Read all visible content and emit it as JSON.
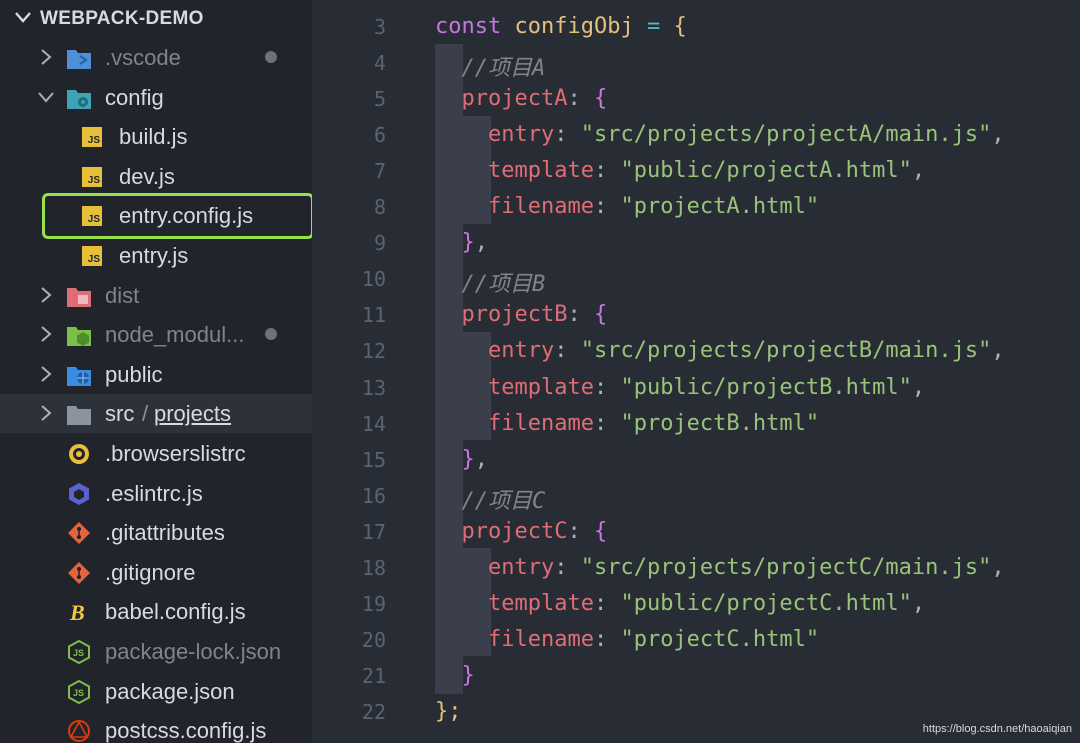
{
  "sidebar": {
    "header": "WEBPACK-DEMO",
    "items": [
      {
        "label": ".vscode",
        "icon": "vscode-folder-icon",
        "chevron": "right",
        "dim": true,
        "dot": true
      },
      {
        "label": "config",
        "icon": "config-folder-icon",
        "chevron": "down"
      },
      {
        "label": "build.js",
        "icon": "javascript-file-icon"
      },
      {
        "label": "dev.js",
        "icon": "javascript-file-icon"
      },
      {
        "label": "entry.config.js",
        "icon": "javascript-file-icon",
        "highlighted": true
      },
      {
        "label": "entry.js",
        "icon": "javascript-file-icon"
      },
      {
        "label": "dist",
        "icon": "dist-folder-icon",
        "chevron": "right",
        "dim": true
      },
      {
        "label": "node_modul...",
        "icon": "node-folder-icon",
        "chevron": "right",
        "dim": true,
        "dot": true
      },
      {
        "label": "public",
        "icon": "public-folder-icon",
        "chevron": "right"
      },
      {
        "label": "src",
        "label_suffix": "projects",
        "icon": "folder-icon",
        "chevron": "right",
        "selected": true
      },
      {
        "label": ".browserslistrc",
        "icon": "browserslist-icon"
      },
      {
        "label": ".eslintrc.js",
        "icon": "eslint-icon"
      },
      {
        "label": ".gitattributes",
        "icon": "git-icon"
      },
      {
        "label": ".gitignore",
        "icon": "git-icon"
      },
      {
        "label": "babel.config.js",
        "icon": "babel-icon"
      },
      {
        "label": "package-lock.json",
        "icon": "nodejs-icon",
        "dim": true
      },
      {
        "label": "package.json",
        "icon": "nodejs-icon"
      },
      {
        "label": "postcss.config.js",
        "icon": "postcss-icon"
      }
    ],
    "separator": "/"
  },
  "editor": {
    "lines": [
      {
        "n": "3",
        "t": [
          [
            "kw",
            "const "
          ],
          [
            "var",
            "configObj"
          ],
          [
            "op",
            " = "
          ],
          [
            "br",
            "{"
          ]
        ]
      },
      {
        "n": "4",
        "t": [
          [
            "cm",
            "  //项目A"
          ]
        ]
      },
      {
        "n": "5",
        "t": [
          [
            "prop",
            "  projectA"
          ],
          [
            "pun",
            ": "
          ],
          [
            "br2",
            "{"
          ]
        ]
      },
      {
        "n": "6",
        "t": [
          [
            "prop",
            "    entry"
          ],
          [
            "pun",
            ": "
          ],
          [
            "str",
            "\"src/projects/projectA/main.js\""
          ],
          [
            "pun",
            ","
          ]
        ]
      },
      {
        "n": "7",
        "t": [
          [
            "prop",
            "    template"
          ],
          [
            "pun",
            ": "
          ],
          [
            "str",
            "\"public/projectA.html\""
          ],
          [
            "pun",
            ","
          ]
        ]
      },
      {
        "n": "8",
        "t": [
          [
            "prop",
            "    filename"
          ],
          [
            "pun",
            ": "
          ],
          [
            "str",
            "\"projectA.html\""
          ]
        ]
      },
      {
        "n": "9",
        "t": [
          [
            "br2",
            "  }"
          ],
          [
            "pun",
            ","
          ]
        ]
      },
      {
        "n": "10",
        "t": [
          [
            "cm",
            "  //项目B"
          ]
        ]
      },
      {
        "n": "11",
        "t": [
          [
            "prop",
            "  projectB"
          ],
          [
            "pun",
            ": "
          ],
          [
            "br2",
            "{"
          ]
        ]
      },
      {
        "n": "12",
        "t": [
          [
            "prop",
            "    entry"
          ],
          [
            "pun",
            ": "
          ],
          [
            "str",
            "\"src/projects/projectB/main.js\""
          ],
          [
            "pun",
            ","
          ]
        ]
      },
      {
        "n": "13",
        "t": [
          [
            "prop",
            "    template"
          ],
          [
            "pun",
            ": "
          ],
          [
            "str",
            "\"public/projectB.html\""
          ],
          [
            "pun",
            ","
          ]
        ]
      },
      {
        "n": "14",
        "t": [
          [
            "prop",
            "    filename"
          ],
          [
            "pun",
            ": "
          ],
          [
            "str",
            "\"projectB.html\""
          ]
        ]
      },
      {
        "n": "15",
        "t": [
          [
            "br2",
            "  }"
          ],
          [
            "pun",
            ","
          ]
        ]
      },
      {
        "n": "16",
        "t": [
          [
            "cm",
            "  //项目C"
          ]
        ]
      },
      {
        "n": "17",
        "t": [
          [
            "prop",
            "  projectC"
          ],
          [
            "pun",
            ": "
          ],
          [
            "br2",
            "{"
          ]
        ]
      },
      {
        "n": "18",
        "t": [
          [
            "prop",
            "    entry"
          ],
          [
            "pun",
            ": "
          ],
          [
            "str",
            "\"src/projects/projectC/main.js\""
          ],
          [
            "pun",
            ","
          ]
        ]
      },
      {
        "n": "19",
        "t": [
          [
            "prop",
            "    template"
          ],
          [
            "pun",
            ": "
          ],
          [
            "str",
            "\"public/projectC.html\""
          ],
          [
            "pun",
            ","
          ]
        ]
      },
      {
        "n": "20",
        "t": [
          [
            "prop",
            "    filename"
          ],
          [
            "pun",
            ": "
          ],
          [
            "str",
            "\"projectC.html\""
          ]
        ]
      },
      {
        "n": "21",
        "t": [
          [
            "br2",
            "  }"
          ]
        ]
      },
      {
        "n": "22",
        "t": [
          [
            "br",
            "};"
          ]
        ]
      }
    ]
  },
  "watermark": "https://blog.csdn.net/haoaiqian",
  "colors": {
    "background": "#282c34",
    "sidebar": "#21252b",
    "highlight": "#98e24c",
    "keyword": "#c678dd",
    "property": "#e06c75",
    "string": "#98c379",
    "variable": "#e5c07b"
  }
}
